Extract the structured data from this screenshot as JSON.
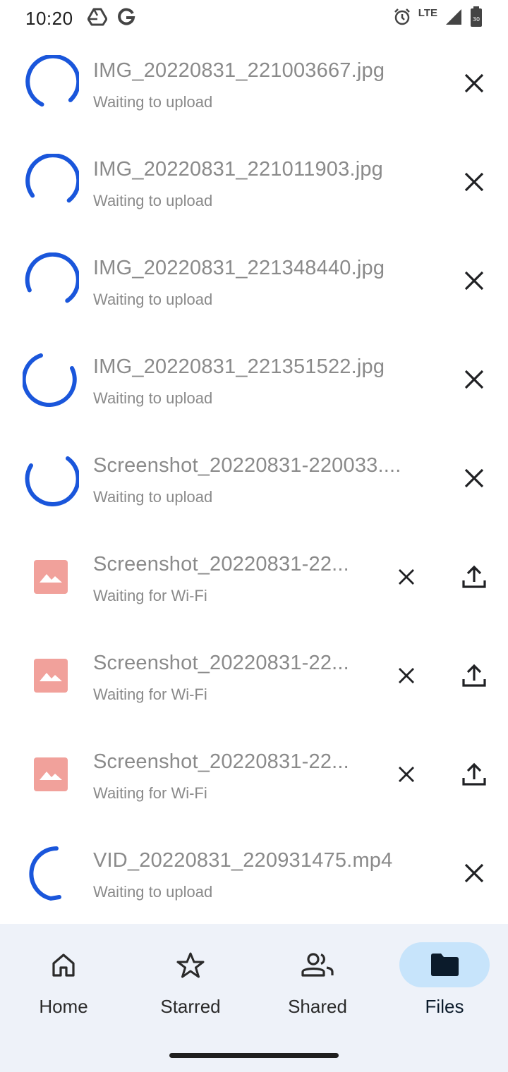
{
  "status_bar": {
    "time": "10:20",
    "network": "LTE",
    "icons": [
      "drive-icon",
      "google-icon",
      "alarm-icon",
      "signal-icon",
      "battery-icon"
    ]
  },
  "uploads": [
    {
      "name": "IMG_20220831_221003667.jpg",
      "status": "Waiting to upload",
      "kind": "spinner"
    },
    {
      "name": "IMG_20220831_221011903.jpg",
      "status": "Waiting to upload",
      "kind": "spinner"
    },
    {
      "name": "IMG_20220831_221348440.jpg",
      "status": "Waiting to upload",
      "kind": "spinner"
    },
    {
      "name": "IMG_20220831_221351522.jpg",
      "status": "Waiting to upload",
      "kind": "spinner"
    },
    {
      "name": "Screenshot_20220831-220033....",
      "status": "Waiting to upload",
      "kind": "spinner"
    },
    {
      "name": "Screenshot_20220831-22...",
      "status": "Waiting for Wi-Fi",
      "kind": "image"
    },
    {
      "name": "Screenshot_20220831-22...",
      "status": "Waiting for Wi-Fi",
      "kind": "image"
    },
    {
      "name": "Screenshot_20220831-22...",
      "status": "Waiting for Wi-Fi",
      "kind": "image"
    },
    {
      "name": "VID_20220831_220931475.mp4",
      "status": "Waiting to upload",
      "kind": "spinner"
    }
  ],
  "nav": {
    "home": "Home",
    "starred": "Starred",
    "shared": "Shared",
    "files": "Files",
    "active": "files"
  },
  "colors": {
    "accent": "#1a56db",
    "thumb": "#f1a19b",
    "active_pill": "#c7e4fb",
    "nav_bg": "#eef2f9"
  }
}
